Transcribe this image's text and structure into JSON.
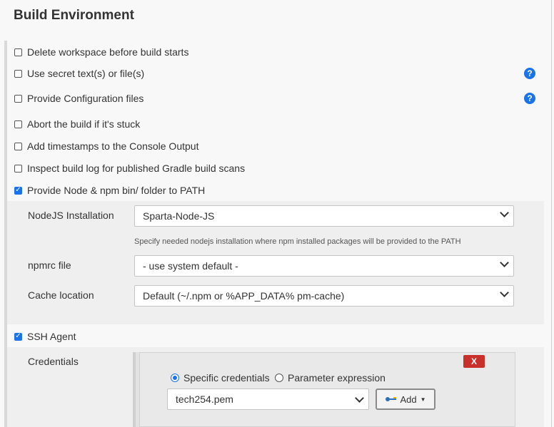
{
  "section": {
    "title": "Build Environment"
  },
  "options": [
    {
      "label": "Delete workspace before build starts",
      "checked": false,
      "help": false
    },
    {
      "label": "Use secret text(s) or file(s)",
      "checked": false,
      "help": true
    },
    {
      "label": "Provide Configuration files",
      "checked": false,
      "help": true
    },
    {
      "label": "Abort the build if it's stuck",
      "checked": false,
      "help": false
    },
    {
      "label": "Add timestamps to the Console Output",
      "checked": false,
      "help": false
    },
    {
      "label": "Inspect build log for published Gradle build scans",
      "checked": false,
      "help": false
    },
    {
      "label": "Provide Node & npm bin/ folder to PATH",
      "checked": true,
      "help": false
    },
    {
      "label": "SSH Agent",
      "checked": true,
      "help": false
    }
  ],
  "node": {
    "installation_label": "NodeJS Installation",
    "installation_value": "Sparta-Node-JS",
    "installation_hint": "Specify needed nodejs installation where npm installed packages will be provided to the PATH",
    "npmrc_label": "npmrc file",
    "npmrc_value": "- use system default -",
    "cache_label": "Cache location",
    "cache_value": "Default (~/.npm or %APP_DATA% pm-cache)"
  },
  "ssh": {
    "credentials_label": "Credentials",
    "delete_label": "X",
    "radio_specific": "Specific credentials",
    "radio_parameter": "Parameter expression",
    "selected_radio": "specific",
    "credential_value": "tech254.pem",
    "add_label": "Add"
  },
  "icons": {
    "help": "question-circle-icon",
    "add": "key-icon",
    "dropdown": "chevron-down-icon"
  },
  "colors": {
    "accent": "#1a73e8",
    "danger": "#c9302c"
  }
}
